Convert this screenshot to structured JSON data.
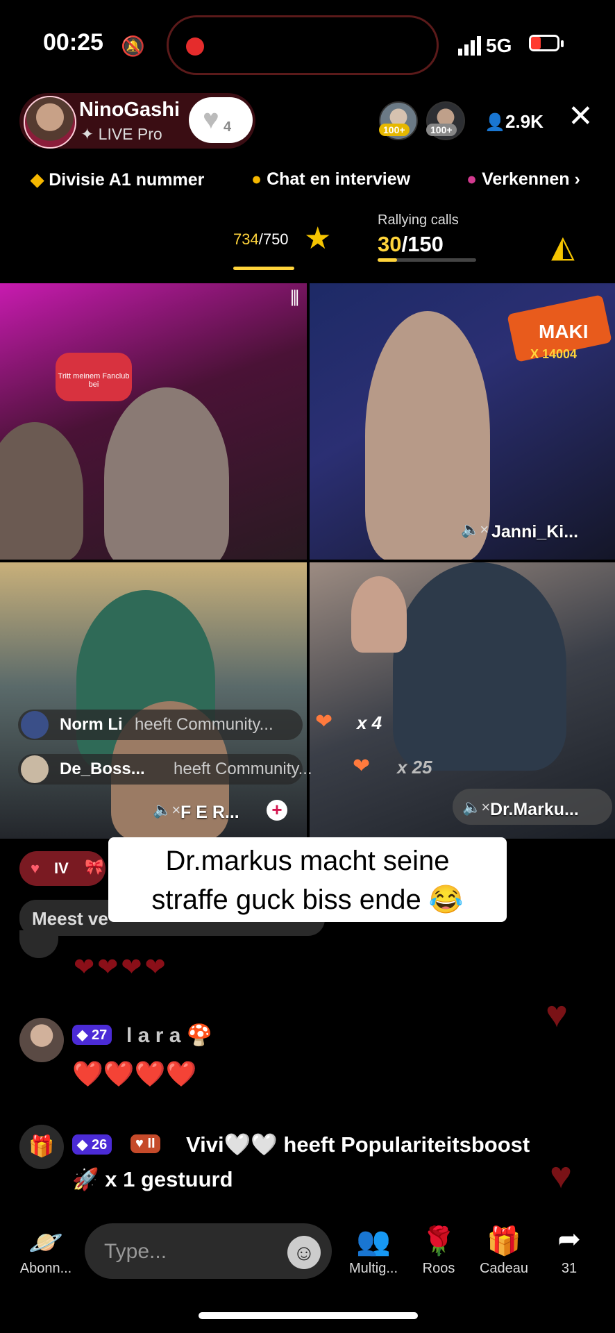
{
  "status_bar": {
    "time": "00:25",
    "network": "5G"
  },
  "host": {
    "name": "NinoGashi",
    "subtitle": "✦ LIVE Pro",
    "likes": "4"
  },
  "viewers": {
    "badges": [
      "100+",
      "100+"
    ],
    "count": "2.9K"
  },
  "links": [
    "Divisie A1 nummer",
    "Chat en interview",
    "Verkennen ›"
  ],
  "progress": {
    "current": "734",
    "total": "/750",
    "rally_title": "Rallying calls",
    "rally_current": "30",
    "rally_total": "/150"
  },
  "tiles": {
    "t1_overlay": "Tritt meinem Fanclub bei",
    "t2_name": "Janni_Ki...",
    "t2_banner": "MAKI",
    "t2_count": "X 14004",
    "t3_name": "F E R...",
    "t4_name": "Dr.Marku...",
    "join_rows": [
      {
        "name": "Norm Li",
        "text": "heeft Community..."
      },
      {
        "name": "De_Boss...",
        "text": "heeft Community..."
      }
    ],
    "gift_counts": [
      "x 4",
      "x 25"
    ]
  },
  "caption": {
    "line1": "Dr.markus macht seine",
    "line2": "straffe guck biss ende 😂"
  },
  "chat": {
    "badge_iv": "IV",
    "meest_label": "Meest ve",
    "hearts_row": "❤❤❤❤",
    "msg1": {
      "level": "27",
      "name": "l a r a 🍄",
      "text": "❤️❤️❤️❤️"
    },
    "msg2": {
      "level": "26",
      "fan": "II",
      "text": "Vivi🤍🤍 heeft Populariteitsboost",
      "text2": "x 1 gestuurd"
    }
  },
  "composer": {
    "placeholder": "Type..."
  },
  "tabbar": [
    {
      "label": "Abonn...",
      "icon": "planet-icon"
    },
    {
      "label": "Multig...",
      "icon": "users-icon"
    },
    {
      "label": "Roos",
      "icon": "rose-icon"
    },
    {
      "label": "Cadeau",
      "icon": "gift-icon"
    },
    {
      "label": "31",
      "icon": "share-icon"
    }
  ],
  "colors": {
    "accent": "#ffd43b",
    "heart": "#e3192b",
    "host_pill": "#3a0d13"
  }
}
